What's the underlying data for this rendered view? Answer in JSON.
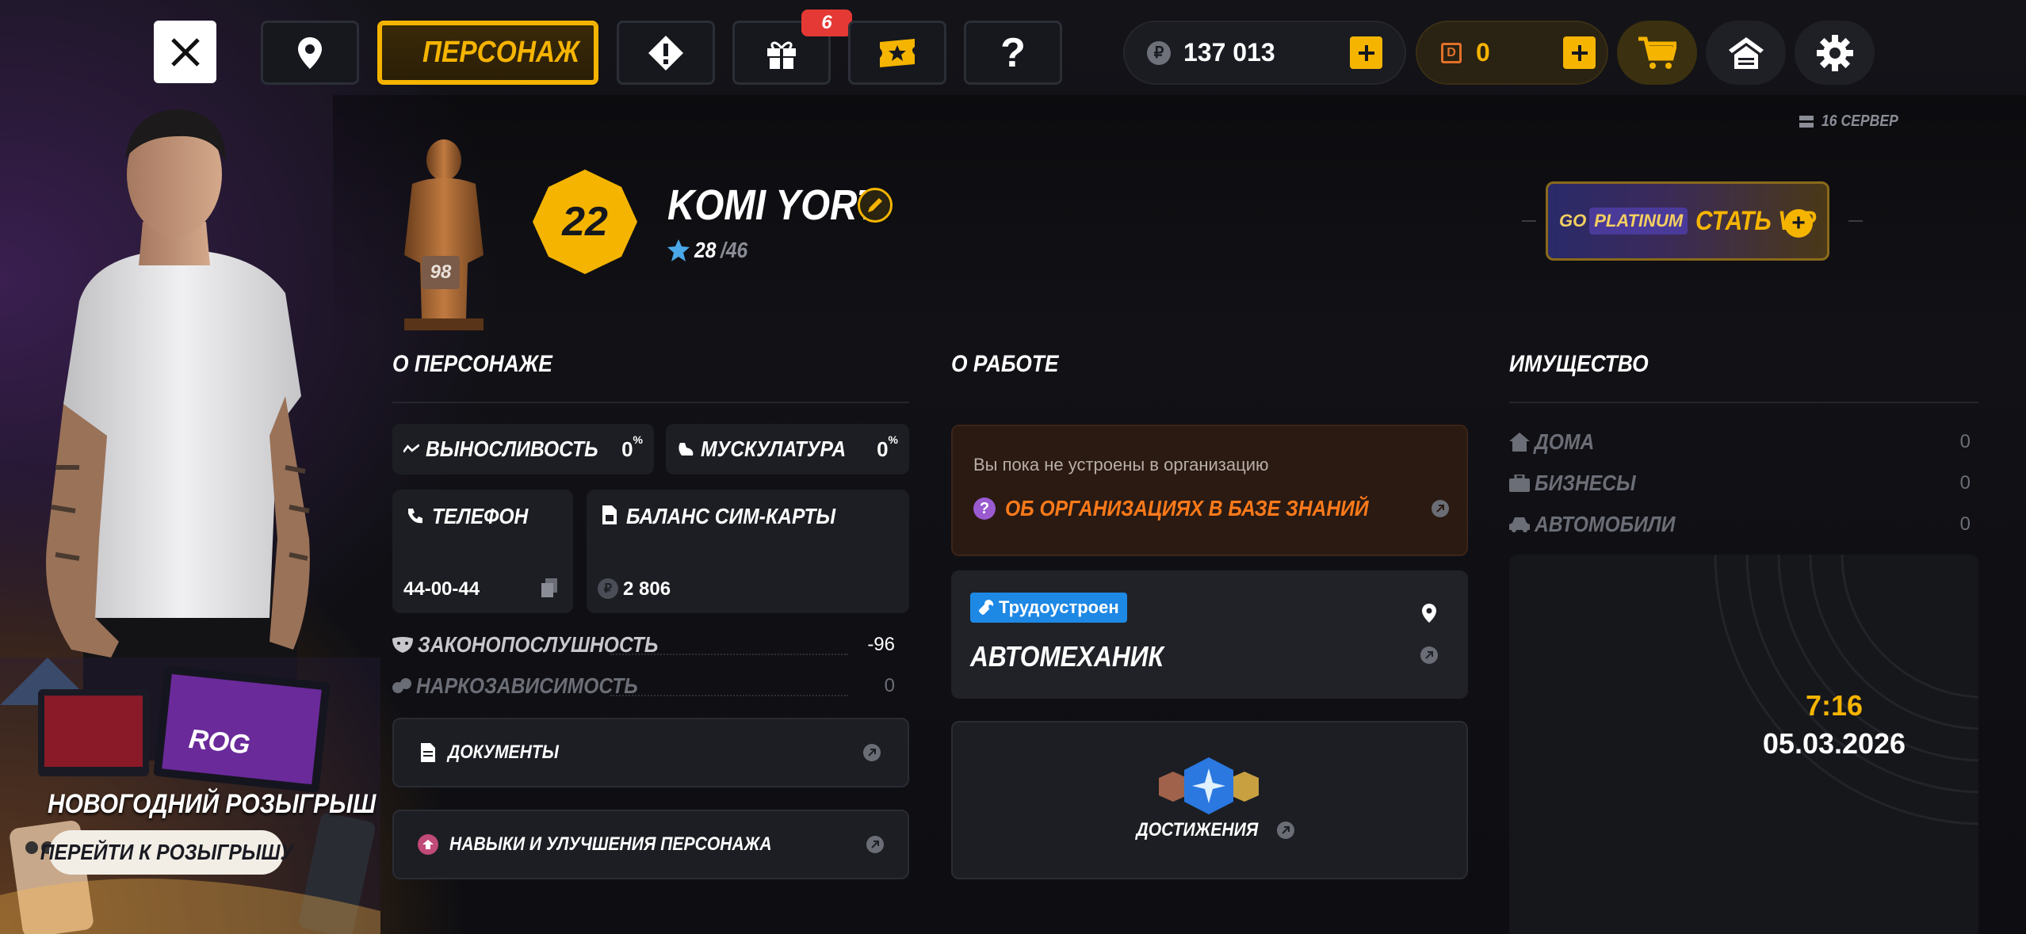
{
  "nav": {
    "active_tab_label": "ПЕРСОНАЖ",
    "gift_badge": "6"
  },
  "currency": {
    "rubles": "137 013",
    "donate": "0"
  },
  "server": "16 СЕРВЕР",
  "profile": {
    "level": "22",
    "name": "KOMI YORT",
    "exp_current": "28",
    "exp_total": "/46",
    "statue_badge": "98"
  },
  "vip": {
    "tier_label": "PLATINUM",
    "brand": "GO",
    "cta": "СТАТЬ VIP"
  },
  "character": {
    "title": "О ПЕРСОНАЖЕ",
    "endurance_label": "ВЫНОСЛИВОСТЬ",
    "endurance_value": "0",
    "muscle_label": "МУСКУЛАТУРА",
    "muscle_value": "0",
    "percent": "%",
    "phone_label": "ТЕЛЕФОН",
    "phone_value": "44-00-44",
    "sim_label": "БАЛАНС СИМ-КАРТЫ",
    "sim_value": "2 806",
    "law_label": "ЗАКОНОПОСЛУШНОСТЬ",
    "law_value": "-96",
    "drug_label": "НАРКОЗАВИСИМОСТЬ",
    "drug_value": "0",
    "documents": "ДОКУМЕНТЫ",
    "skills": "НАВЫКИ И УЛУЧШЕНИЯ ПЕРСОНАЖА"
  },
  "work": {
    "title": "О РАБОТЕ",
    "no_org_text": "Вы пока не устроены в организацию",
    "knowledge_link": "ОБ ОРГАНИЗАЦИЯХ В БАЗЕ ЗНАНИЙ",
    "employed_badge": "Трудоустроен",
    "job_name": "АВТОМЕХАНИК",
    "achievements": "ДОСТИЖЕНИЯ"
  },
  "property": {
    "title": "ИМУЩЕСТВО",
    "houses_label": "ДОМА",
    "houses_value": "0",
    "business_label": "БИЗНЕСЫ",
    "business_value": "0",
    "cars_label": "АВТОМОБИЛИ",
    "cars_value": "0"
  },
  "clock": {
    "time": "7:16",
    "date": "05.03.2026"
  },
  "promo": {
    "title": "НОВОГОДНИЙ РОЗЫГРЫШ",
    "button": "ПЕРЕЙТИ К РОЗЫГРЫШУ"
  },
  "colors": {
    "accent": "#f5b400",
    "orange_link": "#ff7a1a",
    "blue_badge": "#1e88e5",
    "vip_purple": "#4a3a9a"
  }
}
